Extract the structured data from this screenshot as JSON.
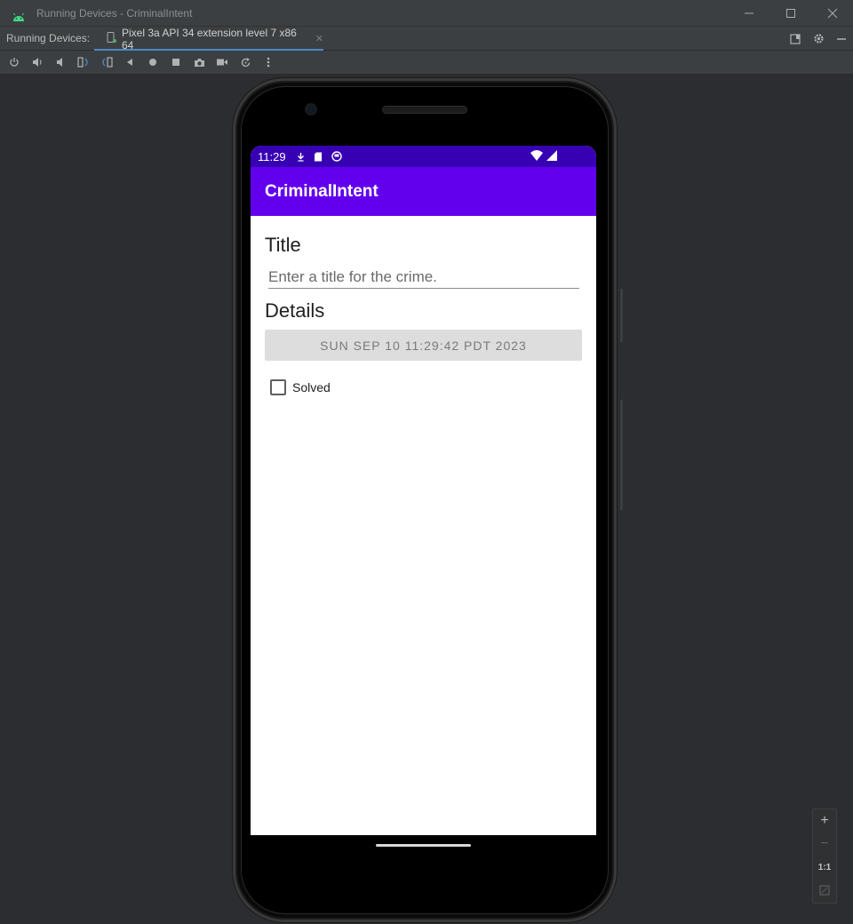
{
  "window": {
    "title": "Running Devices - CriminalIntent",
    "minimize_icon": "minimize-icon",
    "maximize_icon": "maximize-icon",
    "close_icon": "close-icon"
  },
  "tabs": {
    "panel_label": "Running Devices:",
    "device_tab": "Pixel 3a API 34 extension level 7 x86 64",
    "close_glyph": "✕"
  },
  "toolbar": {
    "items": [
      "power-icon",
      "volume-up-icon",
      "volume-down-icon",
      "rotate-left-icon",
      "rotate-right-icon",
      "back-icon",
      "home-icon",
      "overview-icon",
      "screenshot-icon",
      "screen-record-icon",
      "reset-icon",
      "more-icon"
    ]
  },
  "device": {
    "status_time": "11:29",
    "app_title": "CriminalIntent",
    "title_heading": "Title",
    "title_placeholder": "Enter a title for the crime.",
    "details_heading": "Details",
    "date_button": "SUN SEP 10 11:29:42 PDT 2023",
    "solved_label": "Solved",
    "solved_checked": false
  },
  "colors": {
    "status_bar": "#3700b3",
    "app_bar": "#6200ee",
    "ide_background": "#2b2d30",
    "tab_underline": "#4a88c7"
  },
  "zoom": {
    "zoom_in": "+",
    "zoom_out": "−",
    "actual_size": "1:1"
  }
}
